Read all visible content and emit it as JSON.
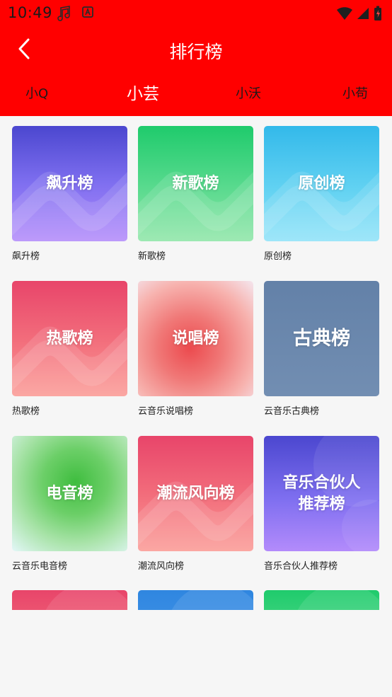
{
  "status": {
    "time": "10:49"
  },
  "header": {
    "title": "排行榜"
  },
  "tabs": [
    {
      "label": "小Q",
      "active": false
    },
    {
      "label": "小芸",
      "active": true
    },
    {
      "label": "小沃",
      "active": false
    },
    {
      "label": "小苟",
      "active": false
    }
  ],
  "charts": [
    {
      "cover": "飙升榜",
      "caption": "飙升榜"
    },
    {
      "cover": "新歌榜",
      "caption": "新歌榜"
    },
    {
      "cover": "原创榜",
      "caption": "原创榜"
    },
    {
      "cover": "热歌榜",
      "caption": "热歌榜"
    },
    {
      "cover": "说唱榜",
      "caption": "云音乐说唱榜"
    },
    {
      "cover": "古典榜",
      "caption": "云音乐古典榜"
    },
    {
      "cover": "电音榜",
      "caption": "云音乐电音榜"
    },
    {
      "cover": "潮流风向榜",
      "caption": "潮流风向榜"
    },
    {
      "cover": "音乐合伙人\n推荐榜",
      "caption": "音乐合伙人推荐榜"
    }
  ]
}
